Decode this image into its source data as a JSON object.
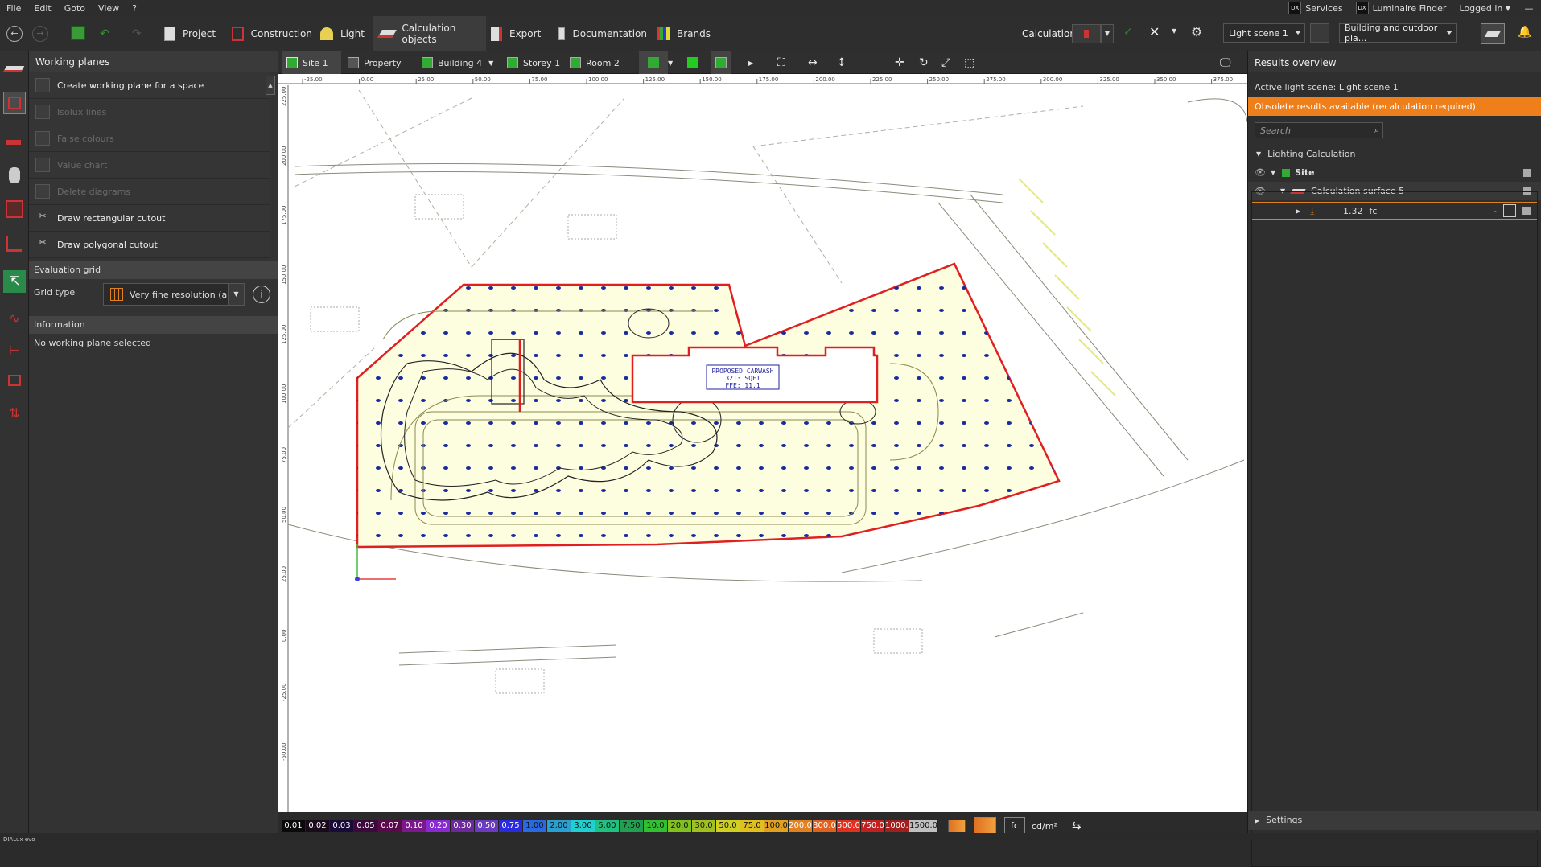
{
  "menu": {
    "items": [
      "File",
      "Edit",
      "Goto",
      "View",
      "?"
    ],
    "services": "Services",
    "luminaire_finder": "Luminaire Finder",
    "logged_in": "Logged in",
    "dx": "DX"
  },
  "toolbar": {
    "tabs": [
      {
        "label": "Project"
      },
      {
        "label": "Construction"
      },
      {
        "label": "Light"
      },
      {
        "label": "Calculation objects"
      },
      {
        "label": "Export"
      },
      {
        "label": "Documentation"
      },
      {
        "label": "Brands"
      }
    ],
    "calculation_label": "Calculation",
    "light_scene": "Light scene 1",
    "view_mode": "Building and outdoor pla..."
  },
  "left_panel": {
    "title": "Working planes",
    "items": [
      {
        "label": "Create working plane for a space",
        "enabled": true
      },
      {
        "label": "Isolux lines",
        "enabled": false
      },
      {
        "label": "False colours",
        "enabled": false
      },
      {
        "label": "Value chart",
        "enabled": false
      },
      {
        "label": "Delete diagrams",
        "enabled": false
      },
      {
        "label": "Draw rectangular cutout",
        "enabled": true
      },
      {
        "label": "Draw polygonal cutout",
        "enabled": true
      }
    ],
    "eval_title": "Evaluation grid",
    "grid_type_label": "Grid type",
    "grid_type_value": "Very fine resolution (a...",
    "info_title": "Information",
    "info_text": "No working plane selected"
  },
  "subbar": {
    "site": "Site 1",
    "property": "Property",
    "building": "Building 4",
    "storey": "Storey 1",
    "room": "Room 2"
  },
  "canvas": {
    "x_ticks": [
      "-25.00",
      "0.00",
      "25.00",
      "50.00",
      "75.00",
      "100.00",
      "125.00",
      "150.00",
      "175.00",
      "200.00",
      "225.00",
      "250.00",
      "275.00",
      "300.00",
      "325.00",
      "350.00",
      "375.00"
    ],
    "y_ticks": [
      "225.00",
      "200.00",
      "175.00",
      "150.00",
      "125.00",
      "100.00",
      "75.00",
      "50.00",
      "25.00",
      "0.00",
      "-25.00",
      "-50.00"
    ],
    "building_label_1": "PROPOSED CARWASH",
    "building_label_2": "3213 SQFT",
    "building_label_3": "FFE: 11.1"
  },
  "legend": {
    "values": [
      "0.01",
      "0.02",
      "0.03",
      "0.05",
      "0.07",
      "0.10",
      "0.20",
      "0.30",
      "0.50",
      "0.75",
      "1.00",
      "2.00",
      "3.00",
      "5.00",
      "7.50",
      "10.0",
      "20.0",
      "30.0",
      "50.0",
      "75.0",
      "100.0",
      "200.0",
      "300.0",
      "500.0",
      "750.0",
      "1000.0",
      "1500.0"
    ],
    "colors": [
      "#0a0a0a",
      "#1a0a1a",
      "#1a0a3a",
      "#3a0a3a",
      "#5a0a4a",
      "#7a1a8a",
      "#8a2ad0",
      "#6a2a9a",
      "#6a3ac0",
      "#2a2ae0",
      "#2a6ae0",
      "#2aa0d0",
      "#20d0d0",
      "#20c080",
      "#20a050",
      "#30c030",
      "#80c020",
      "#a0c020",
      "#d0d020",
      "#e0c020",
      "#e0a020",
      "#e08020",
      "#e06020",
      "#e03020",
      "#c02020",
      "#a02020",
      "#c0c0c0"
    ],
    "unit_fc": "fc",
    "unit_cd": "cd/m²"
  },
  "right_panel": {
    "title": "Results overview",
    "active_scene": "Active light scene: Light scene 1",
    "warning": "Obsolete results available (recalculation required)",
    "search_placeholder": "Search",
    "tree_root": "Lighting Calculation",
    "tree_site": "Site",
    "tree_surface": "Calculation surface 5",
    "result_value": "1.32",
    "result_unit": "fc",
    "settings": "Settings"
  },
  "status": {
    "text": "DIALux evo"
  }
}
